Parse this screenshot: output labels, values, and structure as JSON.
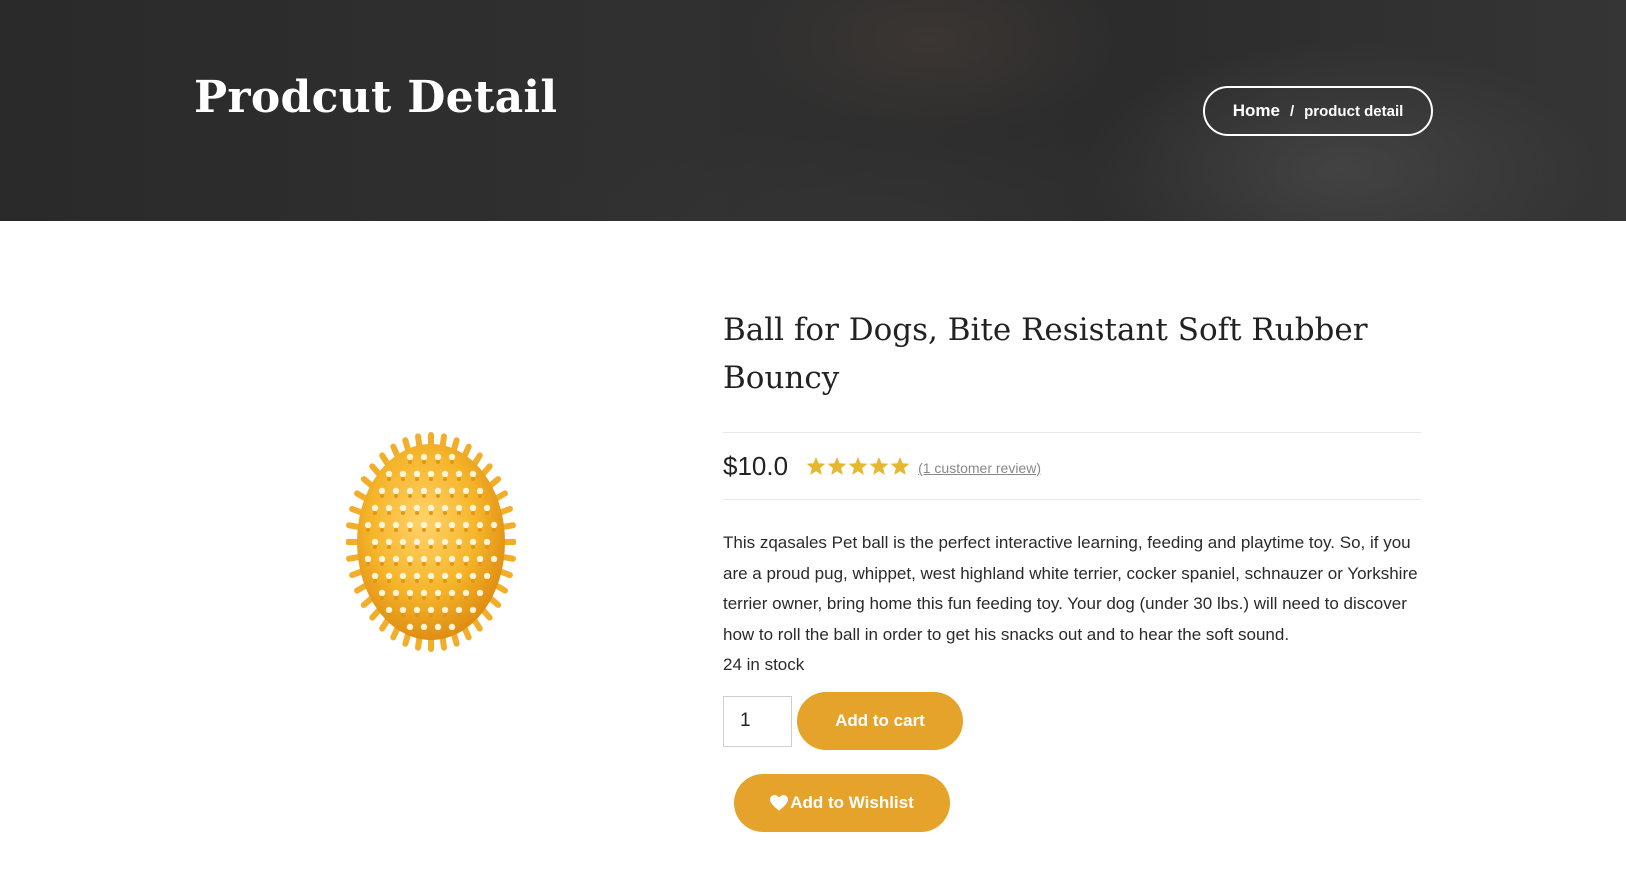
{
  "hero": {
    "title": "Prodcut Detail",
    "breadcrumb": {
      "home_label": "Home",
      "separator": "/",
      "current_label": "product detail"
    }
  },
  "product": {
    "image_icon": "spiky-ball-icon",
    "title": "Ball for Dogs, Bite Resistant Soft Rubber Bouncy",
    "price": "$10.0",
    "rating": 5,
    "rating_max": 5,
    "review_count_text": "(1 customer review)",
    "description": "This zqasales Pet ball is the perfect interactive learning, feeding and playtime toy. So, if you are a proud pug, whippet, west highland white terrier, cocker spaniel, schnauzer or Yorkshire terrier owner, bring home this fun feeding toy. Your dog (under 30 lbs.) will need to discover how to roll the ball in order to get his snacks out and to hear the soft sound.",
    "stock_text": "24 in stock",
    "quantity": "1",
    "add_to_cart_label": "Add to cart",
    "wishlist_label": "Add to Wishlist",
    "wishlist_icon": "heart-icon"
  },
  "colors": {
    "accent": "#e5a32c",
    "star": "#e6b82e",
    "hero_bg": "#2e2e2e",
    "ball": "#f5b52a"
  }
}
